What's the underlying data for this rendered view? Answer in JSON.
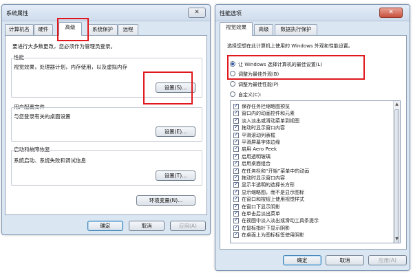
{
  "sysprops": {
    "title": "系统属性",
    "close": "✕",
    "tabs": [
      "计算机名",
      "硬件",
      "高级",
      "系统保护",
      "远程"
    ],
    "admin_note": "要进行大多数更改，您必须作为管理员登录。",
    "performance": {
      "heading": "性能",
      "desc": "视觉效果，处理器计划，内存使用，以及虚拟内存",
      "button": "设置(S)..."
    },
    "user_profiles": {
      "heading": "用户配置文件",
      "desc": "与您登录有关的桌面设置",
      "button": "设置(E)..."
    },
    "startup": {
      "heading": "启动和故障恢复",
      "desc": "系统启动、系统失败和调试信息",
      "button": "设置(T)..."
    },
    "env_button": "环境变量(N)...",
    "ok": "确定",
    "cancel": "取消",
    "apply": "应用(A)"
  },
  "perfopts": {
    "title": "性能选项",
    "close": "✕",
    "tabs": [
      "视觉效果",
      "高级",
      "数据执行保护"
    ],
    "instruction": "选择您想在此计算机上使用的 Windows 外观和性能设置。",
    "radios": [
      {
        "label": "让 Windows 选择计算机的最佳设置(L)",
        "checked": true
      },
      {
        "label": "调整为最佳外观(B)",
        "checked": false
      },
      {
        "label": "调整为最佳性能(P)",
        "checked": false
      },
      {
        "label": "自定义(C):",
        "checked": false
      }
    ],
    "effects": [
      "保存任务栏缩略图预览",
      "窗口内的动画控件和元素",
      "淡入淡出或滑动菜单到视图",
      "拖动时显示窗口内容",
      "平滑滚动列表框",
      "平滑屏幕字体边缘",
      "启用 Aero Peek",
      "启用透明玻璃",
      "启用桌面组合",
      "在任务栏和“开始”菜单中的动画",
      "拖动时显示窗口内容",
      "显示半透明的选择长方形",
      "显示缩略图，而不是显示图标",
      "在窗口和按钮上使用视觉样式",
      "在窗口下显示阴影",
      "在单击后淡出菜单",
      "在视图中淡入淡出或滑动工具条提示",
      "在鼠标指针下显示阴影",
      "在桌面上为图标标签使用阴影"
    ],
    "ok": "确定",
    "cancel": "取消",
    "apply": "应用(A)"
  }
}
